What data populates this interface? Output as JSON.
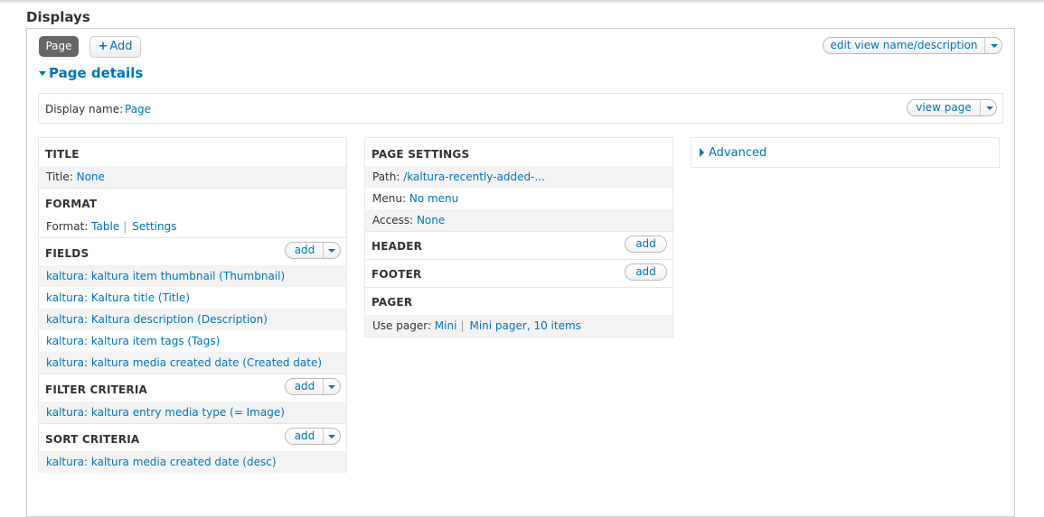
{
  "displays_title": "Displays",
  "tabs": {
    "page": "Page",
    "add": "Add",
    "add_icon": "+"
  },
  "edit_button": "edit view name/description",
  "page_details": "Page details",
  "display_name": {
    "label": "Display name:",
    "value": "Page",
    "view_page": "view page"
  },
  "left": {
    "title": {
      "heading": "TITLE",
      "label": "Title:",
      "value": "None"
    },
    "format": {
      "heading": "FORMAT",
      "label": "Format:",
      "value": "Table",
      "sep": "|",
      "settings": "Settings"
    },
    "fields": {
      "heading": "FIELDS",
      "add": "add",
      "items": [
        "kaltura: kaltura item thumbnail (Thumbnail)",
        "kaltura: Kaltura title (Title)",
        "kaltura: Kaltura description (Description)",
        "kaltura: kaltura item tags (Tags)",
        "kaltura: kaltura media created date (Created date)"
      ]
    },
    "filter": {
      "heading": "FILTER CRITERIA",
      "add": "add",
      "items": [
        "kaltura: kaltura entry media type (= Image)"
      ]
    },
    "sort": {
      "heading": "SORT CRITERIA",
      "add": "add",
      "items": [
        "kaltura: kaltura media created date (desc)"
      ]
    }
  },
  "middle": {
    "page_settings": {
      "heading": "PAGE SETTINGS",
      "path_label": "Path:",
      "path_value": "/kaltura-recently-added-...",
      "menu_label": "Menu:",
      "menu_value": "No menu",
      "access_label": "Access:",
      "access_value": "None"
    },
    "header": {
      "heading": "HEADER",
      "add": "add"
    },
    "footer": {
      "heading": "FOOTER",
      "add": "add"
    },
    "pager": {
      "heading": "PAGER",
      "label": "Use pager:",
      "value": "Mini",
      "sep": "|",
      "detail": "Mini pager, 10 items"
    }
  },
  "advanced": "Advanced",
  "colors": {
    "link": "#0074bd",
    "tab_active_bg": "#666666",
    "row_shade": "#f3f3f3"
  }
}
